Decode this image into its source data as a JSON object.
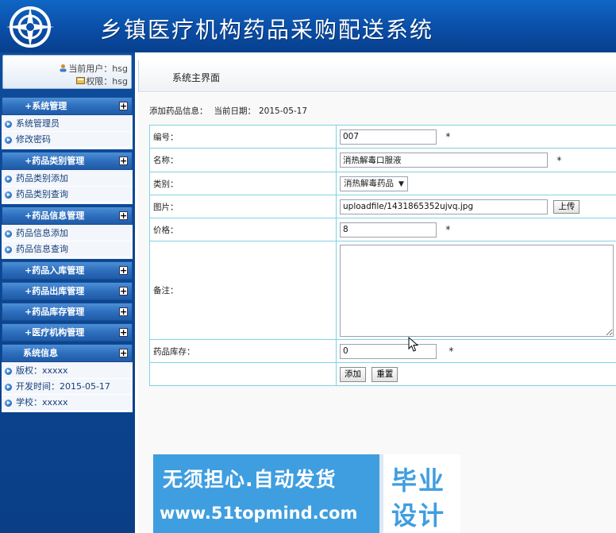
{
  "app": {
    "title": "乡镇医疗机构药品采购配送系统"
  },
  "user": {
    "current_user": "当前用户：hsg",
    "permission": "权限：hsg"
  },
  "menu": {
    "groups": [
      {
        "label": "+系统管理",
        "items": [
          "系统管理员",
          "修改密码"
        ]
      },
      {
        "label": "+药品类别管理",
        "items": [
          "药品类别添加",
          "药品类别查询"
        ]
      },
      {
        "label": "+药品信息管理",
        "items": [
          "药品信息添加",
          "药品信息查询"
        ]
      },
      {
        "label": "+药品入库管理",
        "items": []
      },
      {
        "label": "+药品出库管理",
        "items": []
      },
      {
        "label": "+药品库存管理",
        "items": []
      },
      {
        "label": "+医疗机构管理",
        "items": []
      }
    ],
    "plus_symbol": "+"
  },
  "sysinfo": {
    "title": "系统信息",
    "items": [
      "版权：xxxxx",
      "开发时间：2015-05-17",
      "学校：xxxxx"
    ]
  },
  "breadcrumb": "系统主界面",
  "form": {
    "heading": "添加药品信息：",
    "date_label": "当前日期：",
    "date": "2015-05-17",
    "fields": {
      "code": {
        "label": "编号：",
        "value": "007"
      },
      "name": {
        "label": "名称：",
        "value": "消热解毒口服液"
      },
      "category": {
        "label": "类别：",
        "value": "消热解毒药品"
      },
      "image": {
        "label": "图片：",
        "value": "uploadfile/1431865352ujvq.jpg"
      },
      "price": {
        "label": "价格：",
        "value": "8"
      },
      "note": {
        "label": "备注：",
        "value": ""
      },
      "stock": {
        "label": "药品库存：",
        "value": "0"
      }
    },
    "required_mark": "*",
    "upload_button": "上传",
    "submit_button": "添加",
    "reset_button": "重置"
  },
  "promo": {
    "slogan": "无须担心.自动发货",
    "url": "www.51topmind.com",
    "badge_line1": "毕业",
    "badge_line2": "设计"
  },
  "colors": {
    "header_blue": "#0a4ea7",
    "sidebar_blue": "#0a3f86",
    "table_border": "#7fd3e4",
    "promo_blue": "#3f9ee0"
  }
}
